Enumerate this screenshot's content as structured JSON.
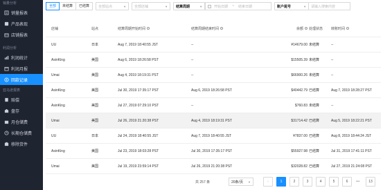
{
  "sidebar": {
    "groups": [
      {
        "title": "销量分析",
        "items": [
          {
            "label": "销量报表",
            "icon": "report-icon"
          },
          {
            "label": "产品表现",
            "icon": "product-icon"
          },
          {
            "label": "店铺报表",
            "icon": "store-icon"
          }
        ]
      },
      {
        "title": "利润分析",
        "items": [
          {
            "label": "利润统计",
            "icon": "stats-icon"
          },
          {
            "label": "利润月报",
            "icon": "monthly-icon"
          },
          {
            "label": "回款记录",
            "icon": "payment-icon",
            "active": true
          }
        ]
      },
      {
        "title": "亚马逊报表",
        "items": [
          {
            "label": "赔偿",
            "icon": "compensation-icon"
          },
          {
            "label": "盘存",
            "icon": "inventory-icon"
          },
          {
            "label": "月仓储费",
            "icon": "storage-fee-icon"
          },
          {
            "label": "长期仓储费",
            "icon": "long-storage-icon"
          },
          {
            "label": "移除货件",
            "icon": "removal-icon"
          }
        ]
      }
    ]
  },
  "filters": {
    "status_tabs": [
      "全部",
      "未结算",
      "已结算"
    ],
    "site_placeholder": "全部站点",
    "store_placeholder": "全部店铺",
    "period_label": "结算周期",
    "start_date": "开始日期",
    "end_date": "结束日期",
    "account_select": "账户尾号",
    "search_placeholder": "请输入搜索内容"
  },
  "table": {
    "headers": [
      "店铺",
      "站点",
      "结算周期开始时间",
      "结算周期结束时间",
      "余额",
      "处理状态",
      "转账时间"
    ],
    "rows": [
      [
        "UU",
        "日本",
        "Aug 7, 2019 18:40:55 JST",
        "--",
        "¥14679.00",
        "未结算",
        "--"
      ],
      [
        "AsinKing",
        "美国",
        "Aug 6, 2019 18:26:58 PST",
        "--",
        "$15505.39",
        "未结算",
        "--"
      ],
      [
        "Umai",
        "美国",
        "Aug 4, 2019 18:19:31 PST",
        "--",
        "$66900.26",
        "未结算",
        "--"
      ],
      [
        "AsinKing",
        "美国",
        "Jul 30, 2019 17:35:17 PST",
        "Aug 6, 2019 18:26:58 PST",
        "$40442.79",
        "已结算",
        "Aug 7, 2019 18:28:27 PST"
      ],
      [
        "AsinKing",
        "美国",
        "Jul 27, 2019 07:29:10 PST",
        "--",
        "$760.83",
        "未结算",
        "--"
      ],
      [
        "Umai",
        "美国",
        "Jul 26, 2019 21:20:38 PST",
        "Aug 4, 2019 18:19:31 PST",
        "$31714.42",
        "已结算",
        "Aug 5, 2019 18:22:21 PST"
      ],
      [
        "UU",
        "日本",
        "Jul 24, 2019 18:40:55 JST",
        "Aug 7, 2019 18:40:55 JST",
        "¥7837.00",
        "已结算",
        "Aug 8, 2019 18:44:24 JST"
      ],
      [
        "AsinKing",
        "美国",
        "Jul 23, 2019 18:03:28 PST",
        "Jul 30, 2019 17:35:17 PST",
        "$55927.98",
        "已结算",
        "Jul 31, 2019 17:41:11 PST"
      ],
      [
        "Umai",
        "美国",
        "Jul 19, 2019 23:59:14 PST",
        "Jul 26, 2019 21:20:38 PST",
        "$32028.82",
        "已结算",
        "Jul 27, 2019 21:24:08 PST"
      ]
    ]
  },
  "pagination": {
    "total": "共 257 条",
    "page_size": "20条/页",
    "pages": [
      "1",
      "2",
      "3",
      "4",
      "5",
      "6"
    ],
    "last_page": "13",
    "current": "1"
  },
  "colors": {
    "accent": "#1890ff",
    "sidebar_bg": "#1f2431"
  }
}
